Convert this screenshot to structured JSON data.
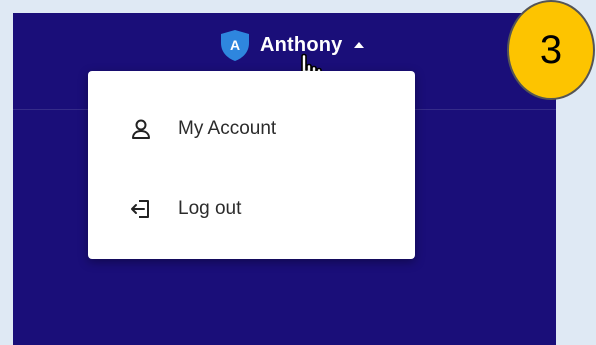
{
  "header": {
    "avatar_initial": "A",
    "user_name": "Anthony",
    "caret_icon": "caret-up-icon"
  },
  "user_menu": {
    "items": [
      {
        "label": "My Account",
        "icon": "person-icon"
      },
      {
        "label": "Log out",
        "icon": "logout-icon"
      }
    ]
  },
  "step_badge": {
    "number": "3"
  },
  "colors": {
    "header_bg": "#1a0e79",
    "shield": "#2e86de",
    "menu_bg": "#ffffff",
    "badge_bg": "#fdc400",
    "outer_bg": "#dfe9f4"
  }
}
